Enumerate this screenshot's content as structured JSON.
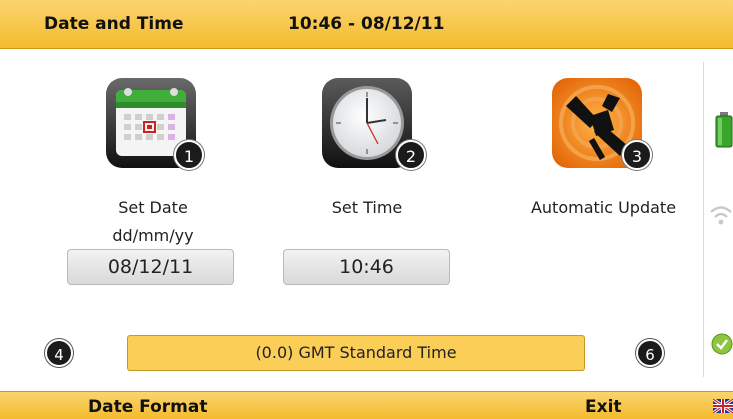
{
  "header": {
    "title": "Date and Time",
    "clock": "10:46 - 08/12/11"
  },
  "tiles": [
    {
      "badge": "1",
      "label": "Set Date",
      "sublabel": "dd/mm/yy",
      "value": "08/12/11"
    },
    {
      "badge": "2",
      "label": "Set Time",
      "value": "10:46"
    },
    {
      "badge": "3",
      "label": "Automatic Update"
    }
  ],
  "timezone": {
    "left_badge": "4",
    "value": "(0.0) GMT Standard Time",
    "right_badge": "6"
  },
  "footer": {
    "left_softkey": "Date Format",
    "right_softkey": "Exit"
  },
  "colors": {
    "accent": "#f3bb2c",
    "accent_light": "#fbd470",
    "timezone_bar": "#fbce58",
    "badge": "#1b1b1b"
  },
  "status_icons": [
    "battery-icon",
    "wifi-icon",
    "check-icon",
    "uk-flag-icon"
  ]
}
